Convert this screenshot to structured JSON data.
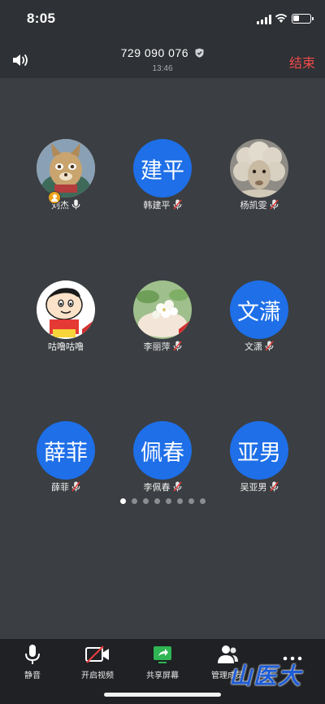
{
  "status_bar": {
    "time": "8:05"
  },
  "header": {
    "meeting_id": "729 090 076",
    "timer": "13:46",
    "end_label": "结束"
  },
  "participants": [
    {
      "name": "刘杰",
      "avatar_type": "image",
      "avatar_desc": "cartoon-fox-icon",
      "mic": "on",
      "host": true
    },
    {
      "name": "韩建平",
      "avatar_type": "text",
      "avatar_text": "建平",
      "mic": "muted"
    },
    {
      "name": "杨凯雯",
      "avatar_type": "image",
      "avatar_desc": "sheep-icon",
      "mic": "muted"
    },
    {
      "name": "咕噜咕噜",
      "avatar_type": "image",
      "avatar_desc": "cartoon-boy-icon",
      "mic": "none"
    },
    {
      "name": "李丽萍",
      "avatar_type": "image",
      "avatar_desc": "flowers-icon",
      "mic": "muted"
    },
    {
      "name": "文潇",
      "avatar_type": "text",
      "avatar_text": "文潇",
      "mic": "muted"
    },
    {
      "name": "薛菲",
      "avatar_type": "text",
      "avatar_text": "薛菲",
      "mic": "muted"
    },
    {
      "name": "李佩春",
      "avatar_type": "text",
      "avatar_text": "佩春",
      "mic": "muted"
    },
    {
      "name": "吴亚男",
      "avatar_type": "text",
      "avatar_text": "亚男",
      "mic": "muted"
    }
  ],
  "pager": {
    "total": 8,
    "current": 1
  },
  "toolbar": {
    "mute_label": "静音",
    "video_label": "开启视频",
    "share_label": "共享屏幕",
    "members_label": "管理成员",
    "more_label": "..."
  },
  "watermark": {
    "text": "山医大"
  },
  "colors": {
    "avatar_blue": "#1e6fe8",
    "end_red": "#f04a4a",
    "share_green": "#2fb553",
    "video_off_red": "#e63c3c"
  }
}
